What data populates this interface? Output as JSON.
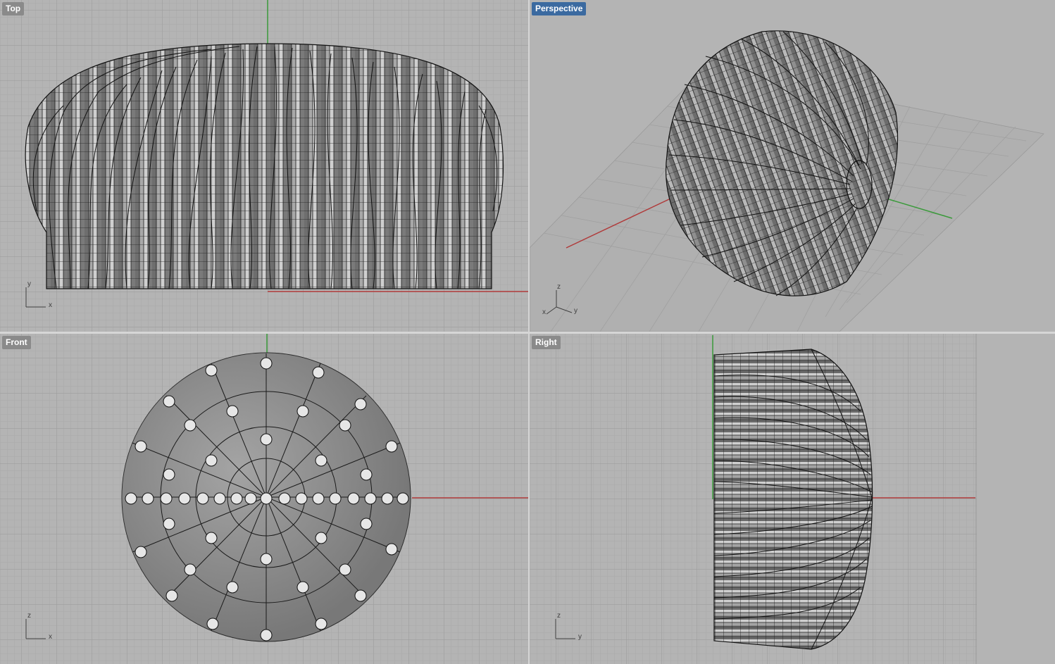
{
  "viewports": {
    "top": {
      "label": "Top",
      "axis_h": "x",
      "axis_v": "y"
    },
    "perspective": {
      "label": "Perspective",
      "axis_a": "z",
      "axis_b": "y",
      "axis_c": "x"
    },
    "front": {
      "label": "Front",
      "axis_h": "x",
      "axis_v": "z"
    },
    "right": {
      "label": "Right",
      "axis_h": "y",
      "axis_v": "z"
    }
  },
  "colors": {
    "background": "#b4b4b4",
    "grid_minor": "#a9a9a9",
    "grid_major": "#9a9a9a",
    "axis_x": "#b03a3a",
    "axis_y": "#3a9a3a",
    "active_label": "#3b6aa0",
    "inactive_label": "#8a8a8a"
  },
  "active_viewport": "perspective"
}
